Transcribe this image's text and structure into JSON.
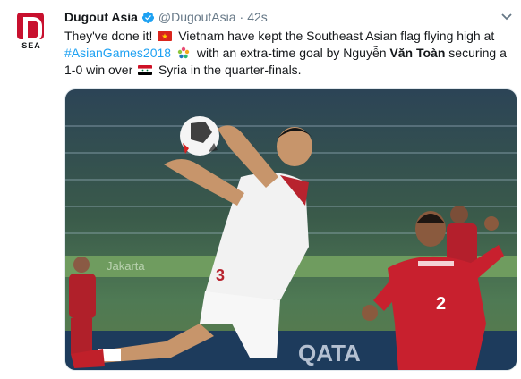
{
  "tweet": {
    "author_name": "Dugout Asia",
    "author_handle": "@DugoutAsia",
    "separator": "·",
    "timestamp": "42s",
    "avatar_label": "SEA",
    "text": {
      "p1": "They've done it!",
      "p2": "Vietnam have kept the Southeast Asian flag flying high at",
      "hashtag": "#AsianGames2018",
      "p3": "with an extra-time goal by Nguyễn",
      "bold_name": "Văn Toàn",
      "p4": "securing a 1-0 win over",
      "p5": "Syria in the quarter-finals."
    },
    "icons": {
      "verified": "verified-badge-icon",
      "caret": "chevron-down-icon",
      "flag_vietnam": "vietnam-flag-icon",
      "flag_syria": "syria-flag-icon",
      "asian_games": "asian-games-emblem-icon"
    },
    "photo": {
      "jersey_number_left": "3",
      "jersey_number_right": "2",
      "ad_text": "QATA",
      "ad_text_left": "Jakarta"
    }
  },
  "colors": {
    "link": "#1da1f2",
    "text": "#14171a",
    "muted": "#657786",
    "brand_red": "#c8102e"
  }
}
